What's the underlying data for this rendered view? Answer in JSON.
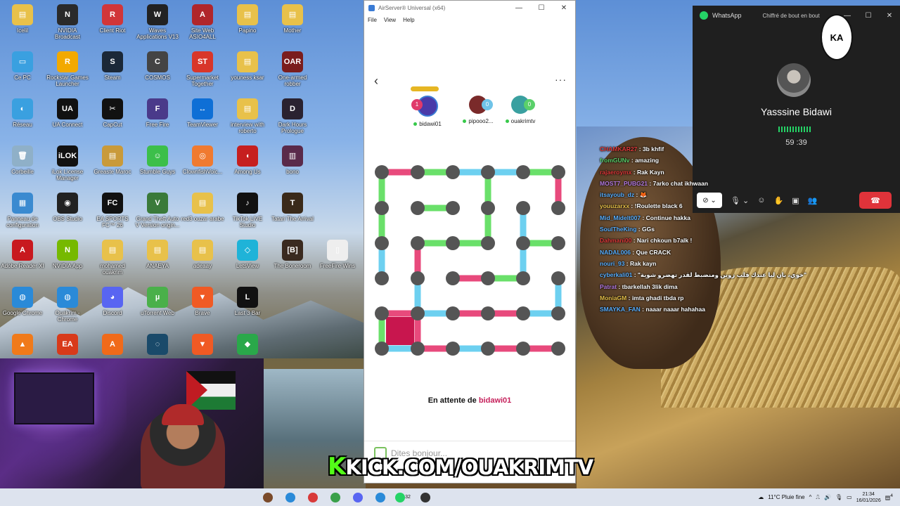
{
  "desktop": {
    "icons": [
      {
        "label": "Icelil",
        "color": "#e8c14a",
        "glyph": "▤"
      },
      {
        "label": "NVIDIA Broadcast",
        "color": "#2a2a2a",
        "glyph": "N"
      },
      {
        "label": "Client Riot",
        "color": "#d13639",
        "glyph": "R"
      },
      {
        "label": "Waves Applications V13",
        "color": "#222222",
        "glyph": "W"
      },
      {
        "label": "Site Web ASIO4ALL",
        "color": "#b0262b",
        "glyph": "A"
      },
      {
        "label": "Papino",
        "color": "#e8c14a",
        "glyph": "▤"
      },
      {
        "label": "Mother",
        "color": "#e8c14a",
        "glyph": "▤"
      },
      {
        "label": "Ce PC",
        "color": "#3aa0e0",
        "glyph": "▭"
      },
      {
        "label": "Rockstar Games Launcher",
        "color": "#f2a900",
        "glyph": "R"
      },
      {
        "label": "Steam",
        "color": "#1b2838",
        "glyph": "S"
      },
      {
        "label": "COSMOS",
        "color": "#444444",
        "glyph": "C"
      },
      {
        "label": "Supermarket Together",
        "color": "#d8362a",
        "glyph": "ST"
      },
      {
        "label": "youness ksar",
        "color": "#e8c14a",
        "glyph": "▤"
      },
      {
        "label": "One-armed robber",
        "color": "#7a1d1d",
        "glyph": "OAR"
      },
      {
        "label": "Réseau",
        "color": "#3aa0e0",
        "glyph": "◐"
      },
      {
        "label": "UA Connect",
        "color": "#111111",
        "glyph": "UA"
      },
      {
        "label": "CapCut",
        "color": "#111111",
        "glyph": "✂"
      },
      {
        "label": "Free Fire",
        "color": "#4a3a8a",
        "glyph": "F"
      },
      {
        "label": "TeamViewer",
        "color": "#0e6fd6",
        "glyph": "↔"
      },
      {
        "label": "interview with roberto",
        "color": "#e8c14a",
        "glyph": "▤"
      },
      {
        "label": "Dark Hours Prologue",
        "color": "#2a2230",
        "glyph": "D"
      },
      {
        "label": "Corbeille",
        "color": "#8fb0c8",
        "glyph": "🗑"
      },
      {
        "label": "iLok License Manager",
        "color": "#111111",
        "glyph": "iLOK"
      },
      {
        "label": "Greaste Maroc",
        "color": "#c99a3a",
        "glyph": "▤"
      },
      {
        "label": "Stumble Guys",
        "color": "#3cbf4a",
        "glyph": "☺"
      },
      {
        "label": "ClownfishVoic...",
        "color": "#f07a30",
        "glyph": "◎"
      },
      {
        "label": "Among Us",
        "color": "#c61f1f",
        "glyph": "◖"
      },
      {
        "label": "bono",
        "color": "#5a2a4a",
        "glyph": "▥"
      },
      {
        "label": "Panneau de configuration",
        "color": "#3a8ad0",
        "glyph": "▦"
      },
      {
        "label": "OBS Studio",
        "color": "#222222",
        "glyph": "◉"
      },
      {
        "label": "EA SPORTS FC™ 26",
        "color": "#111111",
        "glyph": "FC"
      },
      {
        "label": "Grand Theft Auto V Version origin...",
        "color": "#3a7a3a",
        "glyph": "V"
      },
      {
        "label": "red3 ouzar arabe",
        "color": "#e8c14a",
        "glyph": "▤"
      },
      {
        "label": "TikTok LIVE Studio",
        "color": "#111111",
        "glyph": "♪"
      },
      {
        "label": "Tatari The Arrival",
        "color": "#3a2a1a",
        "glyph": "T"
      },
      {
        "label": "Adobe Reader XI",
        "color": "#c8191f",
        "glyph": "A"
      },
      {
        "label": "NVIDIA App",
        "color": "#76b900",
        "glyph": "N"
      },
      {
        "label": "mohamed ouakrim",
        "color": "#e8c14a",
        "glyph": "▤"
      },
      {
        "label": "ANAEYA",
        "color": "#e8c14a",
        "glyph": "▤"
      },
      {
        "label": "adeaay",
        "color": "#e8c14a",
        "glyph": "▤"
      },
      {
        "label": "LetsView",
        "color": "#1fb3d8",
        "glyph": "◇"
      },
      {
        "label": "The Boneroom",
        "color": "#3a2a20",
        "glyph": "[B]"
      },
      {
        "label": "FreeFire Wins",
        "color": "#eeeeee",
        "glyph": "▯"
      },
      {
        "label": "Google Chrome",
        "color": "#2a8ad8",
        "glyph": "◍"
      },
      {
        "label": "Ouakrim - Chrome",
        "color": "#2a8ad8",
        "glyph": "◍"
      },
      {
        "label": "Discord",
        "color": "#5865f2",
        "glyph": "◕"
      },
      {
        "label": "uTorrent Web",
        "color": "#4ab04a",
        "glyph": "µ"
      },
      {
        "label": "Brave",
        "color": "#f05a24",
        "glyph": "▼"
      },
      {
        "label": "Last 3 Bar",
        "color": "#111111",
        "glyph": "L"
      },
      {
        "label": "",
        "color": "#f07a1a",
        "glyph": "▲"
      },
      {
        "label": "",
        "color": "#d83a1a",
        "glyph": "EA"
      },
      {
        "label": "",
        "color": "#f06a1a",
        "glyph": "A"
      },
      {
        "label": "",
        "color": "#1a4a6a",
        "glyph": "◌"
      },
      {
        "label": "",
        "color": "#f05a24",
        "glyph": "▼"
      },
      {
        "label": "",
        "color": "#2aa84a",
        "glyph": "◆"
      }
    ]
  },
  "airserver": {
    "title": "AirServer® Universal (x64)",
    "menu": [
      "File",
      "View",
      "Help"
    ],
    "minimize": "—",
    "maximize": "☐",
    "close": "✕",
    "back": "‹",
    "more": "···",
    "players": [
      {
        "name": "bidawi01",
        "score": "1",
        "score_color": "#e03a6a",
        "avatar_color": "#4a3aa8"
      },
      {
        "name": "pipooo2...",
        "score": "0",
        "score_color": "#6fc3e8",
        "avatar_color": "#7a2a2a"
      },
      {
        "name": "ouakrimtv",
        "score": "0",
        "score_color": "#5ad06a",
        "avatar_color": "#3aa0a0"
      }
    ],
    "waiting_prefix": "En attente de",
    "waiting_user": "bidawi01",
    "input_placeholder": "Dites bonjour..."
  },
  "whatsapp": {
    "app": "WhatsApp",
    "encrypted": "Chiffré de bout en bout",
    "emblem": "KA",
    "caller": "Yasssine Bidawi",
    "duration": "59 :39",
    "controls": {
      "camera": "⊘ ⌄",
      "mic": "🎙 ⌄",
      "emoji": "☺",
      "hand": "✋",
      "screen": "▣",
      "people": "👥",
      "hangup": "☎"
    }
  },
  "chat": [
    {
      "user": "CHAMKAR27",
      "color": "#e03a3a",
      "text": "3b khfif"
    },
    {
      "user": "fromGUNv",
      "color": "#5ad06a",
      "text": "amazing"
    },
    {
      "user": "rajaeroymx",
      "color": "#e03a3a",
      "text": "Rak Kayn"
    },
    {
      "user": "MOST7_PUBG21",
      "color": "#b57be0",
      "text": "7arko chat ikhwaan"
    },
    {
      "user": "itsayoub_dz",
      "color": "#5ab0ff",
      "text": "🦊"
    },
    {
      "user": "youuzarxx",
      "color": "#e8c14a",
      "text": "!Roulette black 6"
    },
    {
      "user": "Mid_Midelt007",
      "color": "#5ab0ff",
      "text": "Continue hakka"
    },
    {
      "user": "SoulTheKing",
      "color": "#5ab0ff",
      "text": "GGs"
    },
    {
      "user": "Dahmani00",
      "color": "#e03a3a",
      "text": "Nari chkoun b7alk !"
    },
    {
      "user": "NADAL006",
      "color": "#5ab0ff",
      "text": "Que CRACK"
    },
    {
      "user": "nouri_93",
      "color": "#5ab0ff",
      "text": "Rak kayn"
    },
    {
      "user": "cyberkali01",
      "color": "#5ab0ff",
      "text": "\"خوي، بان ليا عندك قلب زوين ومنضبط لقدر تهضرو شوية\""
    },
    {
      "user": "Patrat",
      "color": "#b57be0",
      "text": "tbarkellah 3lik dima"
    },
    {
      "user": "MoniaGM",
      "color": "#e8c14a",
      "text": "imta ghadi tbda rp"
    },
    {
      "user": "SMAYKA_FAN",
      "color": "#5ab0ff",
      "text": "naaar naaar hahahaa"
    }
  ],
  "overlay": {
    "kick_k": "K",
    "kick_text": "KICK.COM/OUAKRIMTV"
  },
  "taskbar": {
    "apps": [
      "#7a4a2a",
      "#2a8ad8",
      "#d83a3a",
      "#3aa04a",
      "#5865f2",
      "#2a8ad8",
      "#25d366",
      "#333333"
    ],
    "whatsapp_badge": "32",
    "weather": "11°C Pluie fine",
    "time": "21:34",
    "date": "16/01/2026",
    "notification_badge": "4"
  }
}
